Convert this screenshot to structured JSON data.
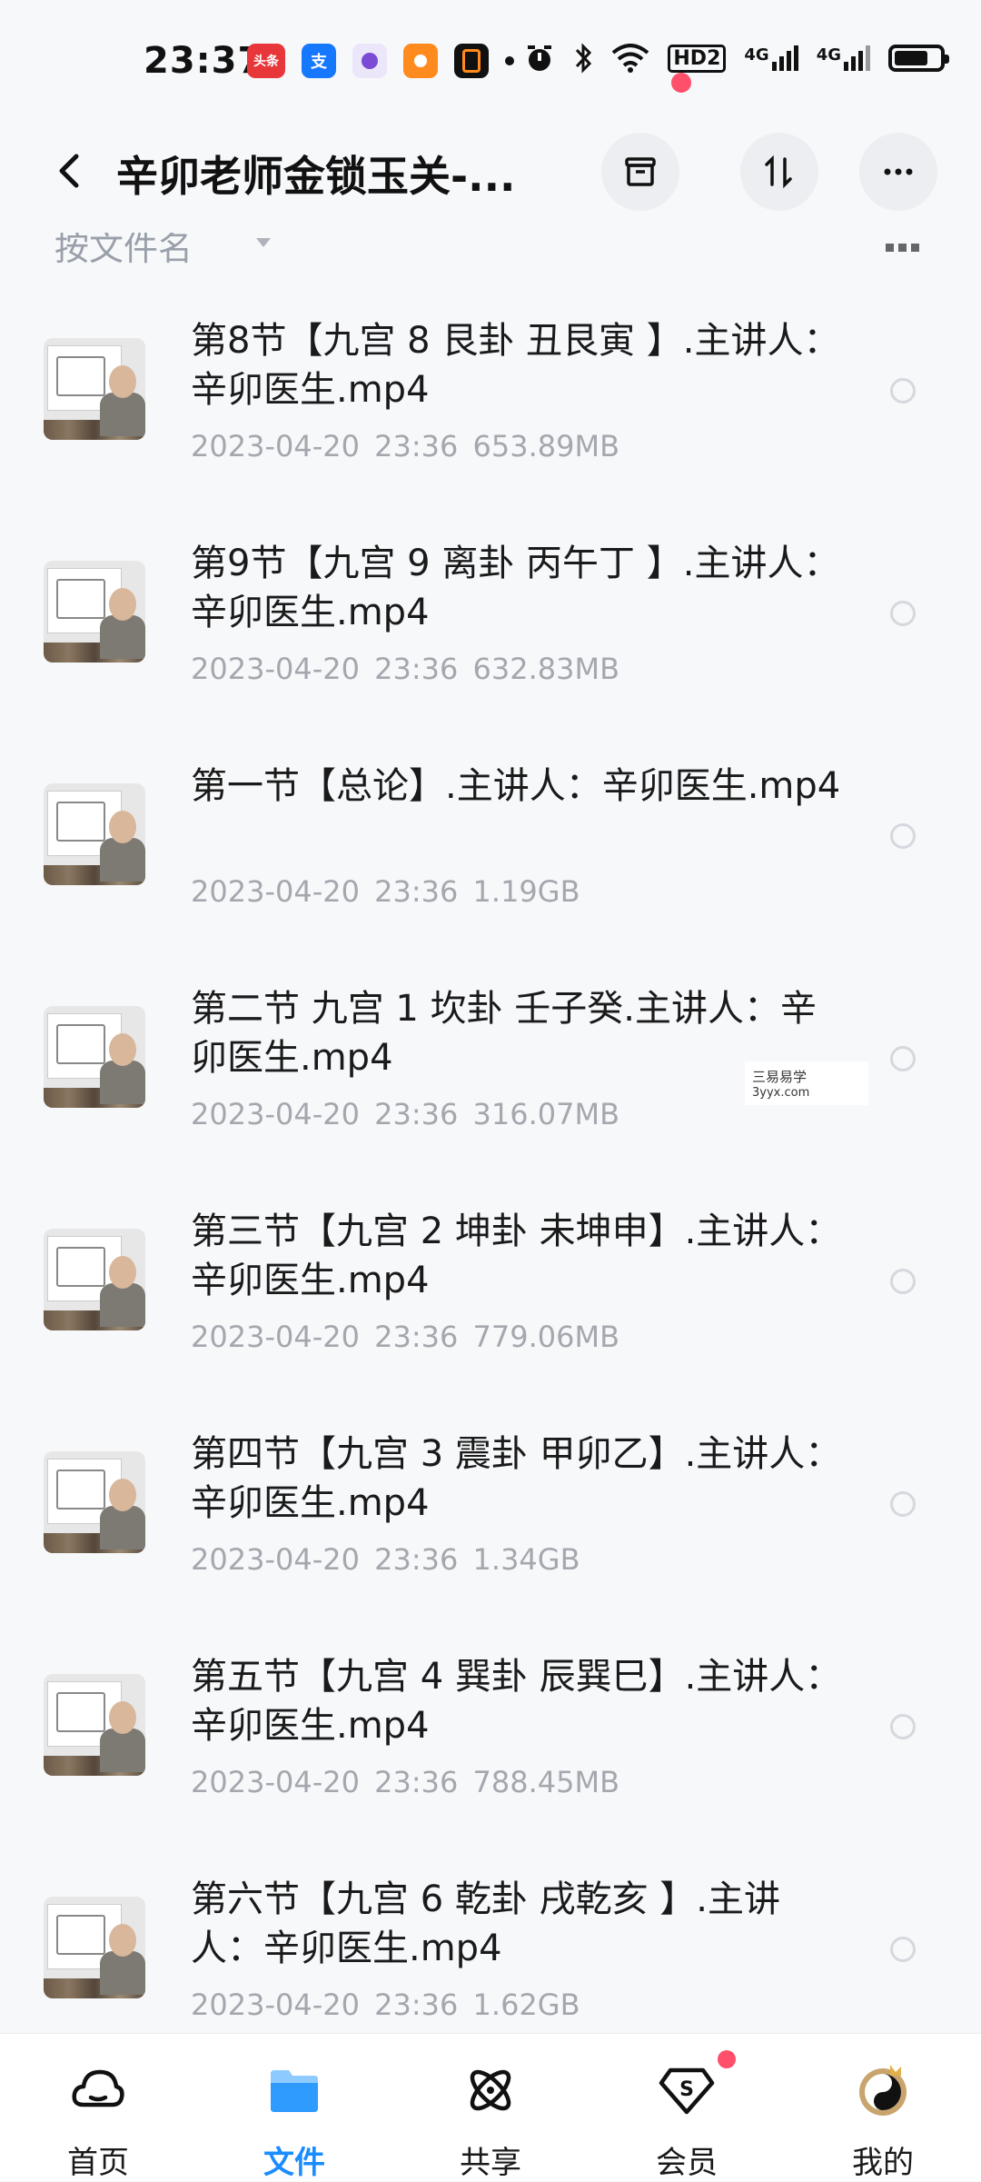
{
  "status_bar": {
    "time": "23:37",
    "apps": [
      {
        "icon": "toutiao-icon",
        "label": "头条",
        "color": "#e8373b"
      },
      {
        "icon": "alipay-icon",
        "label": "支",
        "color": "#1677ff"
      },
      {
        "icon": "app-purple-icon",
        "label": "",
        "color": "#7b4bd6"
      },
      {
        "icon": "app-orange-icon",
        "label": "",
        "color": "#ff8a1e"
      },
      {
        "icon": "app-black-icon",
        "label": "",
        "color": "#111111"
      }
    ],
    "network_labels": [
      "HD2",
      "4G",
      "4G"
    ],
    "battery_level": 0.75
  },
  "header": {
    "title": "辛卯老师金锁玉关-..."
  },
  "sort": {
    "label": "按文件名"
  },
  "files": [
    {
      "name": "第8节【九宫 8 艮卦 丑艮寅 】.主讲人：辛卯医生.mp4",
      "date": "2023-04-20",
      "time": "23:36",
      "size": "653.89MB"
    },
    {
      "name": "第9节【九宫 9 离卦 丙午丁 】.主讲人：辛卯医生.mp4",
      "date": "2023-04-20",
      "time": "23:36",
      "size": "632.83MB"
    },
    {
      "name": "第一节【总论】.主讲人：辛卯医生.mp4",
      "date": "2023-04-20",
      "time": "23:36",
      "size": "1.19GB"
    },
    {
      "name": "第二节 九宫 1 坎卦 壬子癸.主讲人：辛卯医生.mp4",
      "date": "2023-04-20",
      "time": "23:36",
      "size": "316.07MB"
    },
    {
      "name": "第三节【九宫 2 坤卦 未坤申】.主讲人：辛卯医生.mp4",
      "date": "2023-04-20",
      "time": "23:36",
      "size": "779.06MB"
    },
    {
      "name": "第四节【九宫 3 震卦 甲卯乙】.主讲人：辛卯医生.mp4",
      "date": "2023-04-20",
      "time": "23:36",
      "size": "1.34GB"
    },
    {
      "name": "第五节【九宫 4 巽卦 辰巽巳】.主讲人：辛卯医生.mp4",
      "date": "2023-04-20",
      "time": "23:36",
      "size": "788.45MB"
    },
    {
      "name": "第六节【九宫 6 乾卦 戌乾亥 】.主讲人：辛卯医生.mp4",
      "date": "2023-04-20",
      "time": "23:36",
      "size": "1.62GB"
    }
  ],
  "watermark": {
    "line1": "三易易学",
    "line2": "3yyx.com"
  },
  "nav": {
    "home": "首页",
    "files": "文件",
    "share": "共享",
    "vip": "会员",
    "mine": "我的"
  },
  "accent_color": "#1a8cff",
  "badge_color": "#ff4f6a"
}
